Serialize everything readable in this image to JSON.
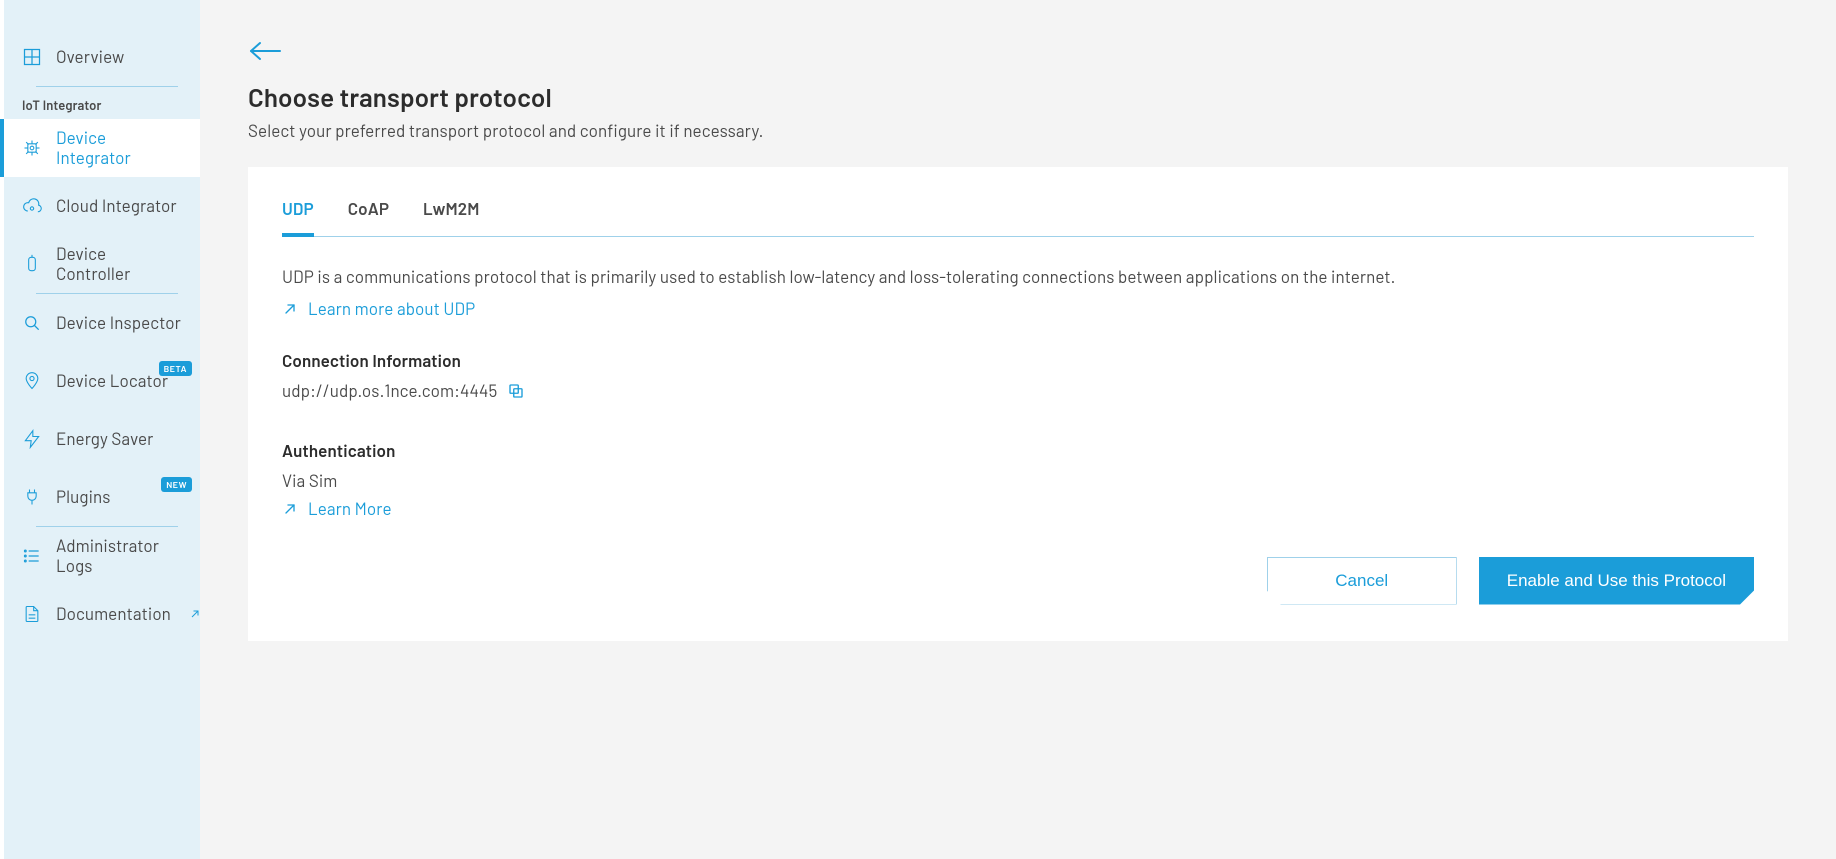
{
  "sidebar": {
    "overview": "Overview",
    "section_label": "IoT Integrator",
    "items": [
      {
        "label": "Device Integrator"
      },
      {
        "label": "Cloud Integrator"
      },
      {
        "label": "Device Controller"
      },
      {
        "label": "Device Inspector"
      },
      {
        "label": "Device Locator",
        "badge": "BETA"
      },
      {
        "label": "Energy Saver"
      },
      {
        "label": "Plugins",
        "badge": "NEW"
      },
      {
        "label": "Administrator Logs"
      },
      {
        "label": "Documentation",
        "external": true
      }
    ]
  },
  "page": {
    "title": "Choose transport protocol",
    "subtitle": "Select your preferred transport protocol and configure it if necessary."
  },
  "tabs": [
    {
      "label": "UDP",
      "active": true
    },
    {
      "label": "CoAP"
    },
    {
      "label": "LwM2M"
    }
  ],
  "content": {
    "description": "UDP is a communications protocol that is primarily used to establish low-latency and loss-tolerating connections between applications on the internet.",
    "learn_more_udp": "Learn more about UDP",
    "connection_heading": "Connection Information",
    "connection_url": "udp://udp.os.1nce.com:4445",
    "auth_heading": "Authentication",
    "auth_value": "Via Sim",
    "learn_more_auth": "Learn More"
  },
  "buttons": {
    "cancel": "Cancel",
    "enable": "Enable and Use this Protocol"
  }
}
